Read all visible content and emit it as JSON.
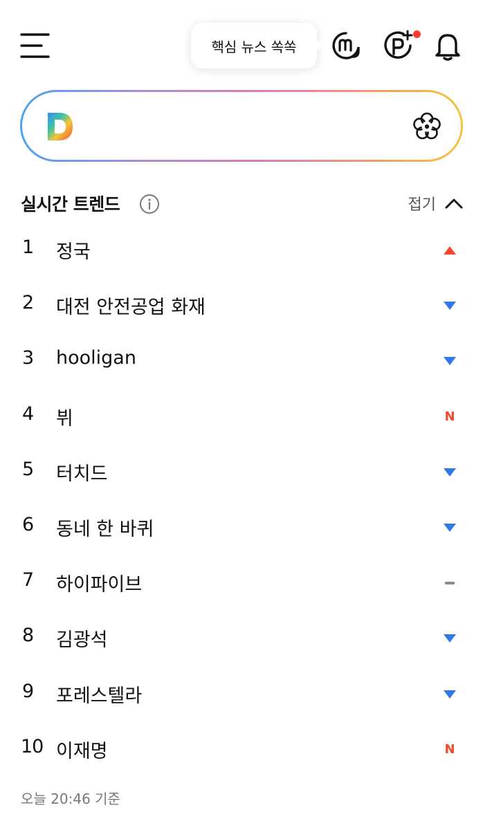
{
  "header": {
    "tooltip_text": "핵심 뉴스 쏙쏙",
    "icons": [
      "menu-icon",
      "mate-icon",
      "point-plus-icon",
      "bell-icon"
    ],
    "notification_dot_color": "#ff3b30"
  },
  "search": {
    "value": "",
    "logo_letter": "D",
    "gradient_colors": [
      "#4aa3f0",
      "#b28ad8",
      "#e07ab5",
      "#f09a6a",
      "#f5c53a"
    ]
  },
  "trends": {
    "title": "실시간 트렌드",
    "collapse_label": "접기",
    "items": [
      {
        "rank": "1",
        "keyword": "정국",
        "status": "up"
      },
      {
        "rank": "2",
        "keyword": "대전 안전공업 화재",
        "status": "down"
      },
      {
        "rank": "3",
        "keyword": "hooligan",
        "status": "down"
      },
      {
        "rank": "4",
        "keyword": "뷔",
        "status": "new",
        "status_text": "N"
      },
      {
        "rank": "5",
        "keyword": "터치드",
        "status": "down"
      },
      {
        "rank": "6",
        "keyword": "동네 한 바퀴",
        "status": "down"
      },
      {
        "rank": "7",
        "keyword": "하이파이브",
        "status": "same"
      },
      {
        "rank": "8",
        "keyword": "김광석",
        "status": "down"
      },
      {
        "rank": "9",
        "keyword": "포레스텔라",
        "status": "down"
      },
      {
        "rank": "10",
        "keyword": "이재명",
        "status": "new",
        "status_text": "N"
      }
    ],
    "status_colors": {
      "up": "#f24a2c",
      "down": "#2f7be5",
      "new": "#f24a2c",
      "same": "#8a8a8a"
    },
    "timestamp": "오늘 20:46 기준"
  }
}
